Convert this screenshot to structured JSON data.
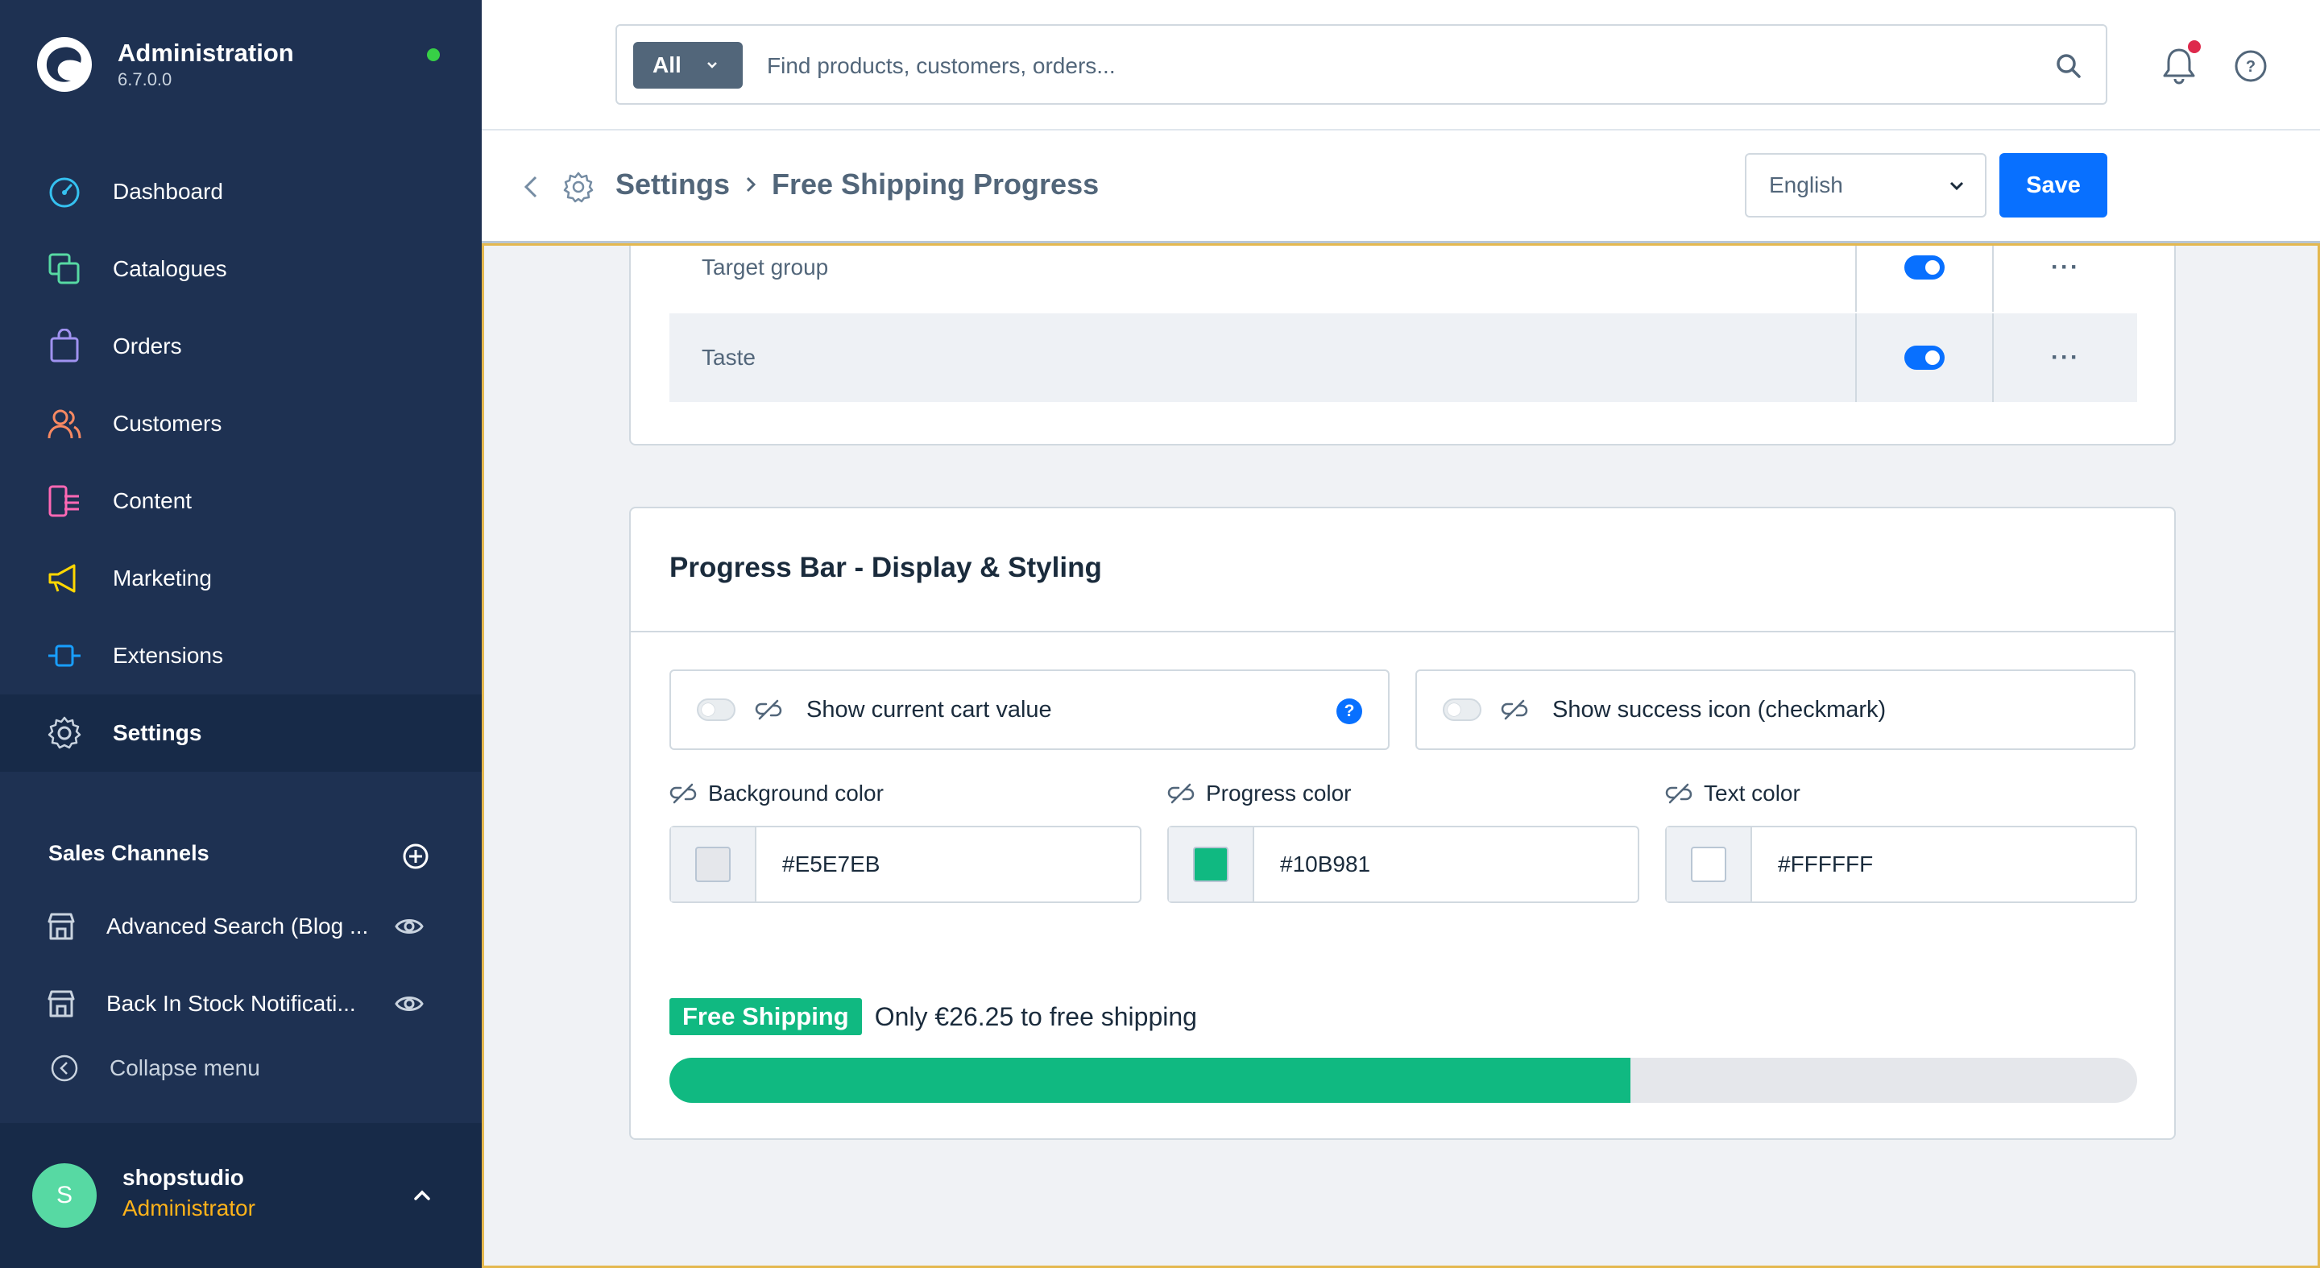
{
  "brand": {
    "title": "Administration",
    "version": "6.7.0.0"
  },
  "nav": [
    {
      "label": "Dashboard",
      "icon": "dashboard-icon",
      "color": "#35c1f0"
    },
    {
      "label": "Catalogues",
      "icon": "catalogues-icon",
      "color": "#57d9a3"
    },
    {
      "label": "Orders",
      "icon": "orders-icon",
      "color": "#a092f0"
    },
    {
      "label": "Customers",
      "icon": "customers-icon",
      "color": "#f88962"
    },
    {
      "label": "Content",
      "icon": "content-icon",
      "color": "#ff68b4"
    },
    {
      "label": "Marketing",
      "icon": "marketing-icon",
      "color": "#ffd700"
    },
    {
      "label": "Extensions",
      "icon": "extensions-icon",
      "color": "#189eff"
    },
    {
      "label": "Settings",
      "icon": "settings-icon",
      "color": "#c9d3df",
      "active": true
    }
  ],
  "sales_channels": {
    "title": "Sales Channels",
    "items": [
      {
        "label": "Advanced Search (Blog ..."
      },
      {
        "label": "Back In Stock Notificati..."
      }
    ],
    "collapse_label": "Collapse menu"
  },
  "user": {
    "initial": "S",
    "name": "shopstudio",
    "role": "Administrator"
  },
  "search": {
    "type_label": "All",
    "placeholder": "Find products, customers, orders..."
  },
  "smartbar": {
    "breadcrumb_parent": "Settings",
    "breadcrumb_current": "Free Shipping Progress",
    "language": "English",
    "save_label": "Save"
  },
  "property_rows": [
    {
      "name": "Target group",
      "active": true
    },
    {
      "name": "Taste",
      "active": true
    }
  ],
  "progress_card": {
    "title": "Progress Bar - Display & Styling",
    "show_cart_value_label": "Show current cart value",
    "show_success_icon_label": "Show success icon (checkmark)",
    "help_glyph": "?",
    "colors": [
      {
        "label": "Background color",
        "value": "#E5E7EB",
        "swatch": "#E5E7EB"
      },
      {
        "label": "Progress color",
        "value": "#10B981",
        "swatch": "#10B981"
      },
      {
        "label": "Text color",
        "value": "#FFFFFF",
        "swatch": "#FFFFFF"
      }
    ],
    "preview": {
      "badge": "Free Shipping",
      "text": "Only €26.25 to free shipping",
      "progress_percent": 65.5
    }
  },
  "colors": {
    "sidebar": "#1e3152",
    "accent": "#0870ff",
    "progress": "#10b981",
    "track": "#e5e7eb"
  }
}
